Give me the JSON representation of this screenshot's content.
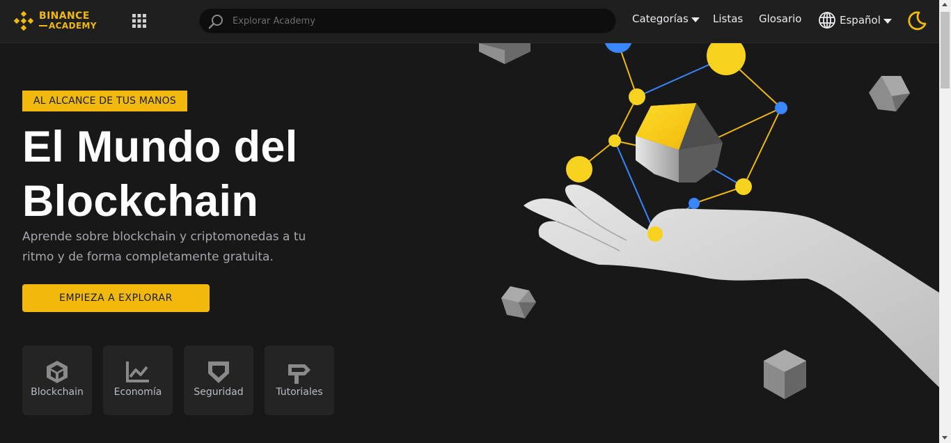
{
  "header": {
    "logo": {
      "line1": "BINANCE",
      "line2": "ACADEMY"
    },
    "search": {
      "placeholder": "Explorar Academy",
      "value": ""
    },
    "nav": {
      "categories": "Categorías",
      "lists": "Listas",
      "glossary": "Glosario",
      "language": "Español"
    }
  },
  "hero": {
    "badge": "AL ALCANCE DE TUS MANOS",
    "title": "El Mundo del Blockchain",
    "subtitle": "Aprende sobre blockchain y criptomonedas a tu ritmo y de forma completamente gratuita.",
    "cta": "EMPIEZA A EXPLORAR"
  },
  "categories": [
    {
      "label": "Blockchain",
      "icon": "cube-icon"
    },
    {
      "label": "Economía",
      "icon": "chart-icon"
    },
    {
      "label": "Seguridad",
      "icon": "shield-icon"
    },
    {
      "label": "Tutoriales",
      "icon": "signpost-icon"
    }
  ],
  "colors": {
    "accent": "#f0b90b",
    "background": "#181818",
    "header": "#1f1f1f",
    "card": "#242424",
    "node_blue": "#3a86ff"
  }
}
